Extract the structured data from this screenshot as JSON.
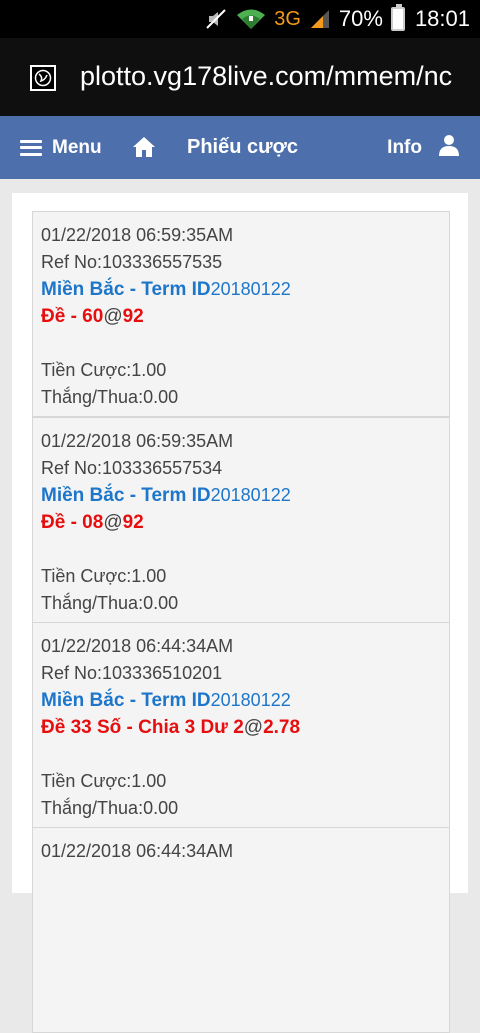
{
  "status_bar": {
    "network": "3G",
    "battery": "70%",
    "time": "18:01"
  },
  "browser": {
    "url": "plotto.vg178live.com/mmem/nc"
  },
  "header": {
    "menu_label": "Menu",
    "title": "Phiếu cược",
    "info_label": "Info"
  },
  "tickets": [
    {
      "datetime": "01/22/2018 06:59:35AM",
      "ref": "Ref No:103336557535",
      "market": "Miền Bắc - Term ID",
      "term": "20180122",
      "bet": "Đề - 60",
      "at": "@",
      "odds": "92",
      "stake": "Tiền Cược:1.00",
      "result": "Thắng/Thua:0.00"
    },
    {
      "datetime": "01/22/2018 06:59:35AM",
      "ref": "Ref No:103336557534",
      "market": "Miền Bắc - Term ID",
      "term": "20180122",
      "bet": "Đề - 08",
      "at": "@",
      "odds": "92",
      "stake": "Tiền Cược:1.00",
      "result": "Thắng/Thua:0.00"
    },
    {
      "datetime": "01/22/2018 06:44:34AM",
      "ref": "Ref No:103336510201",
      "market": "Miền Bắc - Term ID",
      "term": "20180122",
      "bet": "Đề 33 Số - Chia 3 Dư 2",
      "at": "@",
      "odds": "2.78",
      "stake": "Tiền Cược:1.00",
      "result": "Thắng/Thua:0.00"
    },
    {
      "datetime": "01/22/2018 06:44:34AM"
    }
  ]
}
